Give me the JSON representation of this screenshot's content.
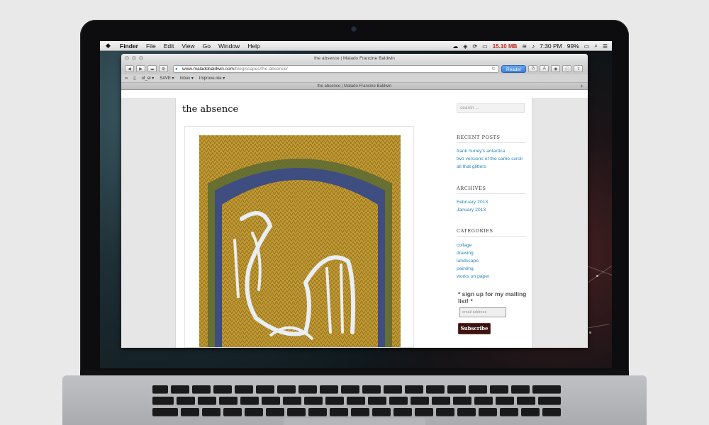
{
  "menubar": {
    "apple": "",
    "items": [
      "Finder",
      "File",
      "Edit",
      "View",
      "Go",
      "Window",
      "Help"
    ],
    "status": {
      "memory": "15.10 MB",
      "battery": "99%",
      "time": "7:30 PM"
    }
  },
  "browser": {
    "window_title": "the absence | Malado Francine Baldwin",
    "url_domain": "www.maladobaldwin.com",
    "url_path": "/blog/scapes/the-absence/",
    "reader_label": "Reader",
    "bookmarks": [
      "of_el ▾",
      "SAVE ▾",
      "Inbox ▾",
      "Improve.me ▾"
    ],
    "tab_title": "the absence | Malado Francine Baldwin",
    "toolbar_icons": [
      "back-icon",
      "forward-icon",
      "icloud-icon",
      "wrench-icon"
    ]
  },
  "page": {
    "post_title": "the absence",
    "search_placeholder": "search ...",
    "recent_posts": {
      "title": "RECENT POSTS",
      "items": [
        "frank hurley's antartica",
        "two versions of the same scroll",
        "all that glitters"
      ]
    },
    "archives": {
      "title": "ARCHIVES",
      "items": [
        "February 2013",
        "January 2013"
      ]
    },
    "categories": {
      "title": "CATEGORIES",
      "items": [
        "collage",
        "drawing",
        "landscape",
        "painting",
        "works on paper"
      ]
    },
    "mailing": {
      "text": "* sign up for my mailing list! *",
      "email_placeholder": "email address",
      "button": "Subscribe"
    }
  },
  "colors": {
    "link": "#2a86b8",
    "reader": "#3c7fd9",
    "subscribe_bg": "#3a1612",
    "art_ochre": "#b8912c",
    "art_green": "#5b6a34",
    "art_blue": "#3b4a8a"
  }
}
